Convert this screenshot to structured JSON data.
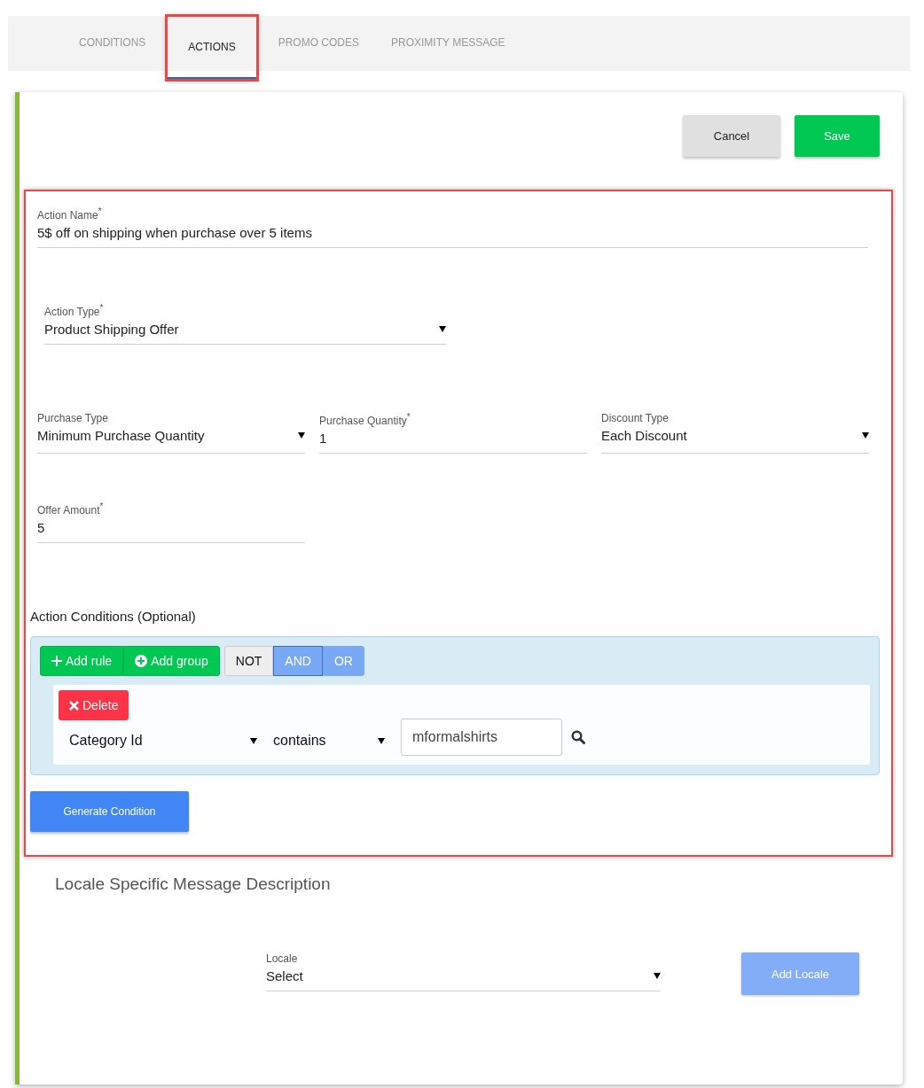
{
  "tabs": [
    {
      "label": "CONDITIONS",
      "selected": false,
      "highlighted": false
    },
    {
      "label": "ACTIONS",
      "selected": true,
      "highlighted": true
    },
    {
      "label": "PROMO CODES",
      "selected": false,
      "highlighted": false
    },
    {
      "label": "PROXIMITY MESSAGE",
      "selected": false,
      "highlighted": false
    }
  ],
  "header_buttons": [
    {
      "label": "Cancel",
      "kind": "secondary"
    },
    {
      "label": "Save",
      "kind": "primary"
    }
  ],
  "action_form": {
    "highlighted": true,
    "action_name": {
      "label": "Action Name$^{*}$",
      "value": "5$ off on shipping when purchase over 5 items"
    },
    "action_type": {
      "label": "Action Type$^{*}$",
      "value": "Product Shipping Offer"
    },
    "purchase_fields": [
      {
        "label": "Purchase Type",
        "value": "Minimum Purchase Quantity",
        "kind": "select"
      },
      {
        "label": "Purchase Quantity$^{*}$",
        "value": "1",
        "kind": "input"
      },
      {
        "label": "Discount Type",
        "value": "Each Discount",
        "kind": "select"
      }
    ],
    "offer_amount": {
      "label": "Offer Amount$^{*}$",
      "value": "5"
    },
    "conditions_title": "Action Conditions (Optional)",
    "query_builder": {
      "add_rule": "Add rule",
      "add_group": "Add group",
      "not": {
        "label": "NOT",
        "on": false
      },
      "combinators": [
        {
          "label": "AND",
          "selected": true
        },
        {
          "label": "OR",
          "selected": false
        }
      ],
      "rule": {
        "delete": "Delete",
        "field": "Category Id",
        "operator": "contains",
        "value": "mformalshirts"
      }
    },
    "generate_button": "Generate Condition"
  },
  "locale_section": {
    "title": "Locale Specific Message Description",
    "locale": {
      "label": "Locale",
      "value": "Select"
    },
    "add_button": {
      "label": "Add Locale",
      "disabled": true
    }
  }
}
